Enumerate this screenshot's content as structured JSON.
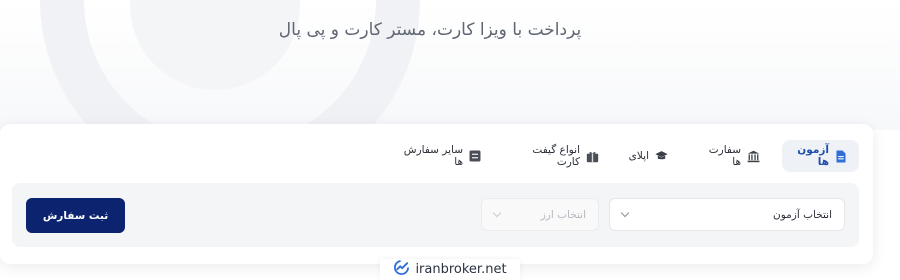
{
  "hero": {
    "headline": "پرداخت با ویزا کارت، مستر کارت و پی پال"
  },
  "tabs": [
    {
      "label": "آزمون ها",
      "icon": "document-icon",
      "active": true
    },
    {
      "label": "سفارت ها",
      "icon": "embassy-icon",
      "active": false
    },
    {
      "label": "اپلای",
      "icon": "graduation-cap-icon",
      "active": false
    },
    {
      "label": "انواع گیفت کارت",
      "icon": "gift-card-icon",
      "active": false
    },
    {
      "label": "سایر سفارش ها",
      "icon": "list-icon",
      "active": false
    }
  ],
  "form": {
    "exam_select": {
      "value": "انتخاب آزمون"
    },
    "currency_select": {
      "placeholder": "انتخاب ارز",
      "disabled": true
    },
    "submit_label": "ثبت سفارش"
  },
  "watermark": {
    "text": "iranbroker.net"
  },
  "colors": {
    "primary": "#0c2470",
    "active_tab_text": "#1d4ea8",
    "active_tab_bg": "#eef1f6",
    "panel_bg": "#f4f5f7",
    "watermark_logo": "#2f6fd8"
  }
}
